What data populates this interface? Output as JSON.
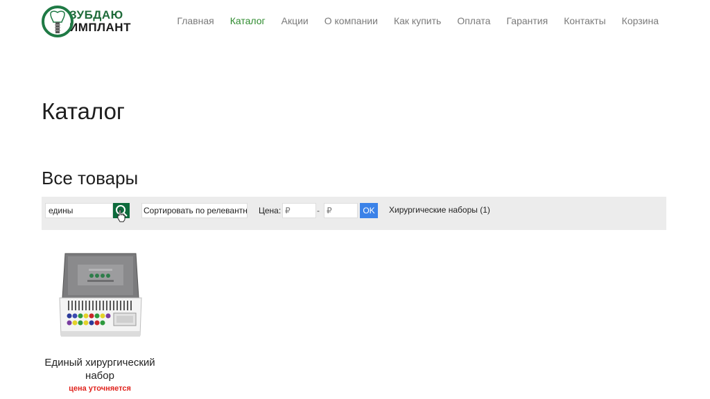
{
  "header": {
    "logo": {
      "line1": "ЗУБДАЮ",
      "line2": "ИМПЛАНТ"
    },
    "nav": [
      {
        "label": "Главная",
        "active": false
      },
      {
        "label": "Каталог",
        "active": true
      },
      {
        "label": "Акции",
        "active": false
      },
      {
        "label": "О компании",
        "active": false
      },
      {
        "label": "Как купить",
        "active": false
      },
      {
        "label": "Оплата",
        "active": false
      },
      {
        "label": "Гарантия",
        "active": false
      },
      {
        "label": "Контакты",
        "active": false
      },
      {
        "label": "Корзина",
        "active": false
      }
    ]
  },
  "page": {
    "title": "Каталог",
    "section_title": "Все товары"
  },
  "filters": {
    "search_value": "едины",
    "search_icon": "search-icon",
    "sort_value": "Сортировать по релевантности",
    "price_label": "Цена:",
    "price_from_placeholder": "₽",
    "price_dash": "-",
    "price_to_placeholder": "₽",
    "ok_label": "OK",
    "category": "Хирургические наборы (1)"
  },
  "products": [
    {
      "name": "Единый хирургический набор",
      "price": "цена уточняется"
    }
  ],
  "colors": {
    "brand_green": "#0d6b3c",
    "nav_active": "#2e8b2e",
    "ok_blue": "#3b82e8",
    "price_red": "#e0241e",
    "filter_bg": "#ececec"
  }
}
